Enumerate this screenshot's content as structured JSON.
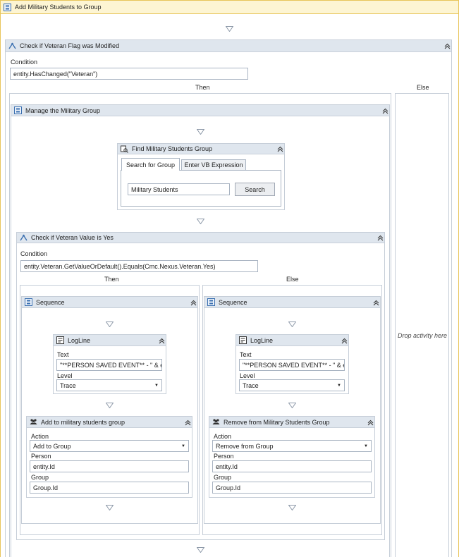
{
  "root": {
    "title": "Add Military Students to Group"
  },
  "outer_if": {
    "title": "Check if Veteran Flag was Modified",
    "condition_label": "Condition",
    "condition_value": "entity.HasChanged(\"Veteran\")",
    "then_label": "Then",
    "else_label": "Else",
    "else_drop_text": "Drop activity here"
  },
  "manage_group": {
    "title": "Manage the Military Group"
  },
  "find_group": {
    "title": "Find Military Students Group",
    "tabs": [
      "Search for Group",
      "Enter VB Expression"
    ],
    "search_value": "Military Students",
    "search_button": "Search"
  },
  "inner_if": {
    "title": "Check if Veteran Value is Yes",
    "condition_label": "Condition",
    "condition_value": "entity.Veteran.GetValueOrDefault().Equals(Cmc.Nexus.Veteran.Yes)",
    "then_label": "Then",
    "else_label": "Else"
  },
  "then_seq": {
    "title": "Sequence",
    "log": {
      "title": "LogLine",
      "text_label": "Text",
      "text_value": "\"**PERSON SAVED EVENT** - \" & en",
      "level_label": "Level",
      "level_value": "Trace"
    },
    "group": {
      "title": "Add to military students group",
      "action_label": "Action",
      "action_value": "Add to Group",
      "person_label": "Person",
      "person_value": "entity.Id",
      "group_label": "Group",
      "group_value": "Group.Id"
    }
  },
  "else_seq": {
    "title": "Sequence",
    "log": {
      "title": "LogLine",
      "text_label": "Text",
      "text_value": "\"**PERSON SAVED EVENT** - \" & en",
      "level_label": "Level",
      "level_value": "Trace"
    },
    "group": {
      "title": "Remove from Military Students Group",
      "action_label": "Action",
      "action_value": "Remove from Group",
      "person_label": "Person",
      "person_value": "entity.Id",
      "group_label": "Group",
      "group_value": "Group.Id"
    }
  },
  "colors": {
    "root_header": "#fdf5d3",
    "root_border": "#e8c55a",
    "gray_header": "#dfe6ee",
    "icon_blue": "#3a6fb0"
  }
}
